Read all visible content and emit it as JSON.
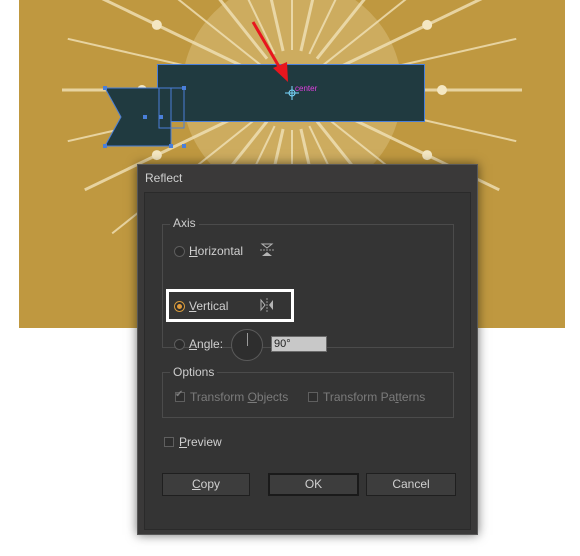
{
  "canvas": {
    "background_color": "#bf9840",
    "banner_color": "#203a40",
    "selection_color": "#4a7fd9",
    "center_label": "center",
    "arrow_color": "#e8161e"
  },
  "dialog": {
    "title": "Reflect",
    "axis": {
      "group_label": "Axis",
      "horizontal": {
        "label": "Horizontal",
        "mnemonic": "H",
        "rest": "orizontal",
        "selected": false,
        "icon": "reflect-horizontal-icon"
      },
      "vertical": {
        "label": "Vertical",
        "mnemonic": "V",
        "rest": "ertical",
        "selected": true,
        "icon": "reflect-vertical-icon"
      },
      "angle": {
        "label": "Angle:",
        "mnemonic": "A",
        "rest": "ngle:",
        "selected": false,
        "value": "90°"
      }
    },
    "options": {
      "group_label": "Options",
      "transform_objects": {
        "label": "Transform Objects",
        "pre": "Transform ",
        "mnemonic": "O",
        "rest": "bjects",
        "checked": true
      },
      "transform_patterns": {
        "label": "Transform Patterns",
        "pre": "Transform Pa",
        "mnemonic": "t",
        "rest": "terns",
        "checked": false
      }
    },
    "preview": {
      "label": "Preview",
      "mnemonic": "P",
      "rest": "review",
      "checked": false
    },
    "buttons": {
      "copy": {
        "label": "Copy",
        "mnemonic": "C",
        "rest": "opy"
      },
      "ok": {
        "label": "OK"
      },
      "cancel": {
        "label": "Cancel"
      }
    },
    "highlight_color": "#ffffff"
  }
}
